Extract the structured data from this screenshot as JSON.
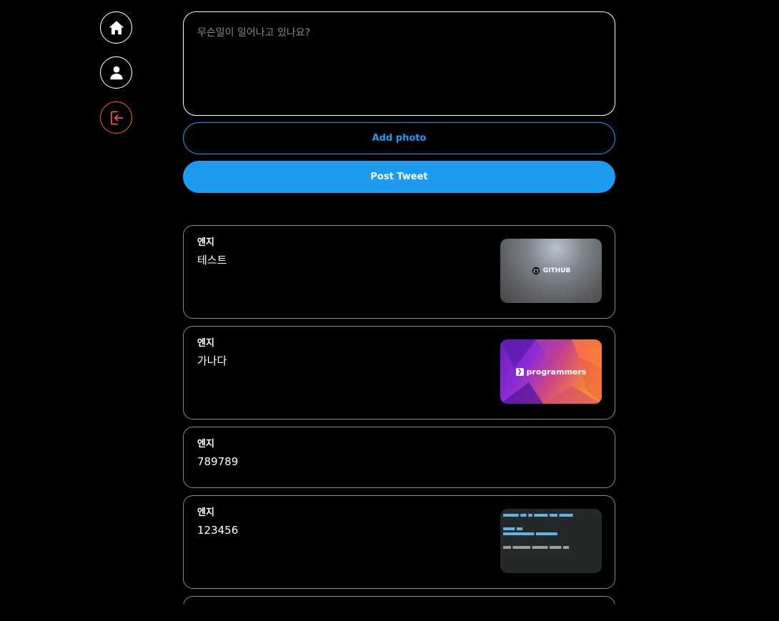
{
  "sidebar": {
    "items": [
      {
        "name": "home",
        "icon": "home-icon"
      },
      {
        "name": "profile",
        "icon": "user-icon"
      },
      {
        "name": "logout",
        "icon": "logout-icon",
        "color": "#ef5a3c"
      }
    ]
  },
  "composer": {
    "placeholder": "무슨일이 일어나고 있나요?",
    "add_photo_label": "Add photo",
    "post_label": "Post Tweet",
    "accent": "#1d9bf0"
  },
  "tweets": [
    {
      "author": "엔지",
      "text": "테스트",
      "image": "github-thumbnail",
      "image_caption": "GITHUB"
    },
    {
      "author": "엔지",
      "text": "가나다",
      "image": "programmers-thumbnail",
      "image_caption": "programmers"
    },
    {
      "author": "엔지",
      "text": "789789"
    },
    {
      "author": "엔지",
      "text": "123456",
      "image": "code-screenshot-thumbnail"
    }
  ]
}
